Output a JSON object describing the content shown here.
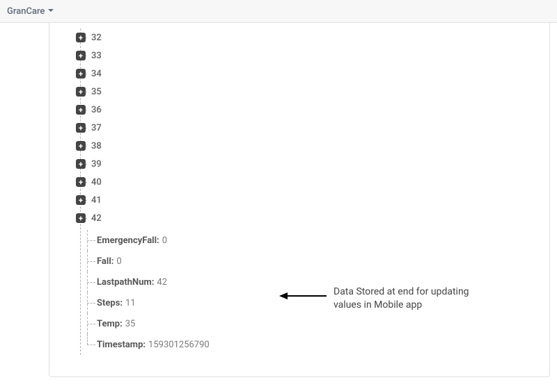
{
  "header": {
    "app_name": "GranCare"
  },
  "tree": {
    "nodes": [
      {
        "label": "32"
      },
      {
        "label": "33"
      },
      {
        "label": "34"
      },
      {
        "label": "35"
      },
      {
        "label": "36"
      },
      {
        "label": "37"
      },
      {
        "label": "38"
      },
      {
        "label": "39"
      },
      {
        "label": "40"
      },
      {
        "label": "41"
      },
      {
        "label": "42"
      }
    ],
    "leaves": [
      {
        "key": "EmergencyFall:",
        "value": "0"
      },
      {
        "key": "Fall:",
        "value": "0"
      },
      {
        "key": "LastpathNum:",
        "value": "42"
      },
      {
        "key": "Steps:",
        "value": "11"
      },
      {
        "key": "Temp:",
        "value": "35"
      },
      {
        "key": "Timestamp:",
        "value": "159301256790"
      }
    ]
  },
  "annotation": {
    "line1": "Data Stored at end for updating",
    "line2": "values in Mobile app"
  },
  "icons": {
    "expander_glyph": "+"
  }
}
